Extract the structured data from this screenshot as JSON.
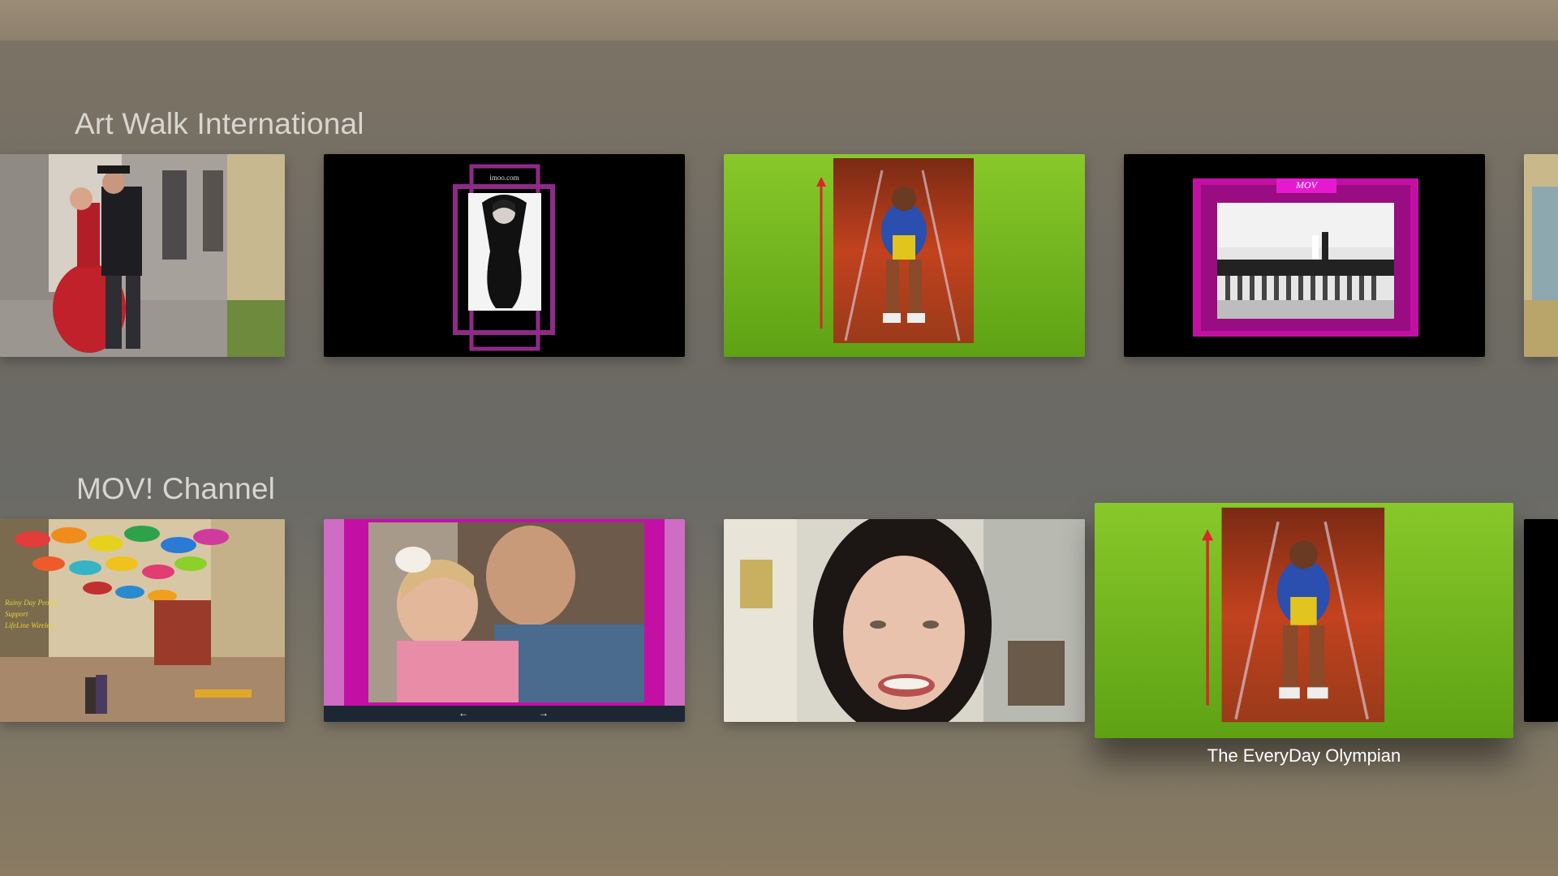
{
  "rows": [
    {
      "title": "Art Walk International",
      "tiles": [
        {
          "name": "tango-dancers"
        },
        {
          "name": "imoo-fashion",
          "overlay_text": "imoo.com"
        },
        {
          "name": "sprinter-green"
        },
        {
          "name": "wedding-bw",
          "overlay_text": "MOV"
        },
        {
          "name": "painting-partial"
        }
      ]
    },
    {
      "title": "MOV! Channel",
      "tiles": [
        {
          "name": "umbrella-street",
          "overlay_lines": [
            "Rainy Day People",
            "Support",
            "LifeLine Wireless"
          ]
        },
        {
          "name": "father-daughter"
        },
        {
          "name": "smiling-woman"
        },
        {
          "name": "everyday-olympian",
          "focused": true,
          "caption": "The EveryDay Olympian"
        },
        {
          "name": "black-partial"
        }
      ]
    }
  ],
  "colors": {
    "accent_magenta": "#c40fa5",
    "accent_green": "#7cc21f",
    "caption_text": "#ffffff",
    "row_title_text": "#d9d6cf"
  }
}
